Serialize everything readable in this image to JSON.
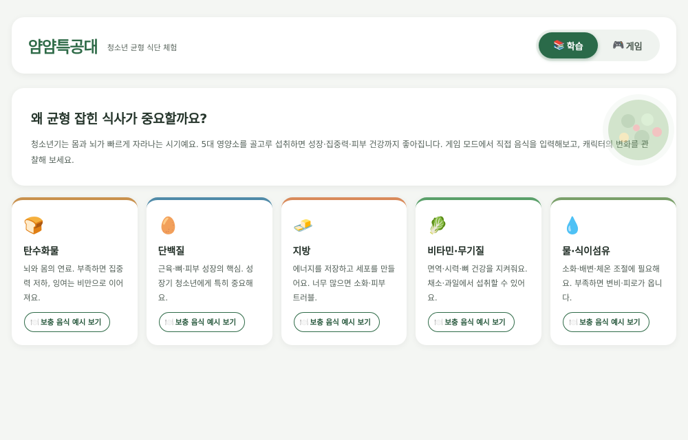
{
  "header": {
    "logo": "얌얌특공대",
    "subtitle": "청소년 균형 식단 체험",
    "modes": [
      {
        "icon": "📚",
        "label": "학습",
        "active": true
      },
      {
        "icon": "🎮",
        "label": "게임",
        "active": false
      }
    ]
  },
  "intro": {
    "title": "왜 균형 잡힌 식사가 중요할까요?",
    "body": "청소년기는 몸과 뇌가 빠르게 자라나는 시기예요. 5대 영양소를 골고루 섭취하면 성장·집중력·피부 건강까지 좋아집니다. 게임 모드에서 직접 음식을 입력해보고, 캐릭터의 변화를 관찰해 보세요."
  },
  "nutrients": [
    {
      "emoji": "🍞",
      "title": "탄수화물",
      "desc": "뇌와 몸의 연료. 부족하면 집중력 저하, 잉여는 비만으로 이어져요.",
      "button": "보충 음식 예시 보기",
      "accent": "#c9914d"
    },
    {
      "emoji": "🥚",
      "title": "단백질",
      "desc": "근육·뼈·피부 성장의 핵심. 성장기 청소년에게 특히 중요해요.",
      "button": "보충 음식 예시 보기",
      "accent": "#4f8aa8"
    },
    {
      "emoji": "🧈",
      "title": "지방",
      "desc": "에너지를 저장하고 세포를 만들어요. 너무 많으면 소화·피부 트러블.",
      "button": "보충 음식 예시 보기",
      "accent": "#d98a5a"
    },
    {
      "emoji": "🥬",
      "title": "비타민·무기질",
      "desc": "면역·시력·뼈 건강을 지켜줘요. 채소·과일에서 섭취할 수 있어요.",
      "button": "보충 음식 예시 보기",
      "accent": "#5aa06a"
    },
    {
      "emoji": "💧",
      "title": "물·식이섬유",
      "desc": "소화·배변·체온 조절에 필요해요. 부족하면 변비·피로가 옵니다.",
      "button": "보충 음식 예시 보기",
      "accent": "#7aa06a"
    }
  ],
  "icons": {
    "button_icon": "🍽️"
  }
}
